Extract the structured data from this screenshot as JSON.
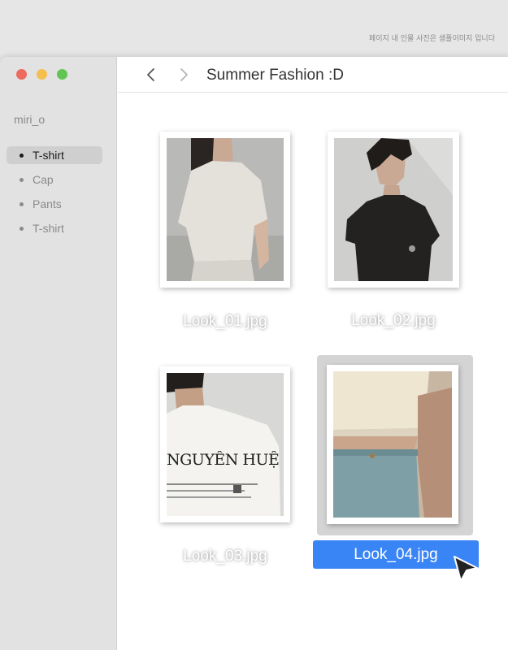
{
  "notice": "페이지 내 인물 사진은 샘플이미지 입니다",
  "window": {
    "user": "miri_o",
    "sidebar": {
      "items": [
        {
          "label": "T-shirt",
          "selected": true
        },
        {
          "label": "Cap",
          "selected": false
        },
        {
          "label": "Pants",
          "selected": false
        },
        {
          "label": "T-shirt",
          "selected": false
        }
      ]
    },
    "toolbar": {
      "back_icon": "chevron-left-icon",
      "forward_icon": "chevron-right-icon",
      "title": "Summer Fashion :D"
    },
    "files": [
      {
        "name": "Look_01.jpg",
        "selected": false
      },
      {
        "name": "Look_02.jpg",
        "selected": false
      },
      {
        "name": "Look_03.jpg",
        "selected": false,
        "print": "NGUYỄN HUỆ"
      },
      {
        "name": "Look_04.jpg",
        "selected": true
      }
    ]
  },
  "colors": {
    "selection": "#3a85f6",
    "close": "#ed6a5e",
    "minimize": "#f5bf4f",
    "zoom": "#61c554"
  }
}
